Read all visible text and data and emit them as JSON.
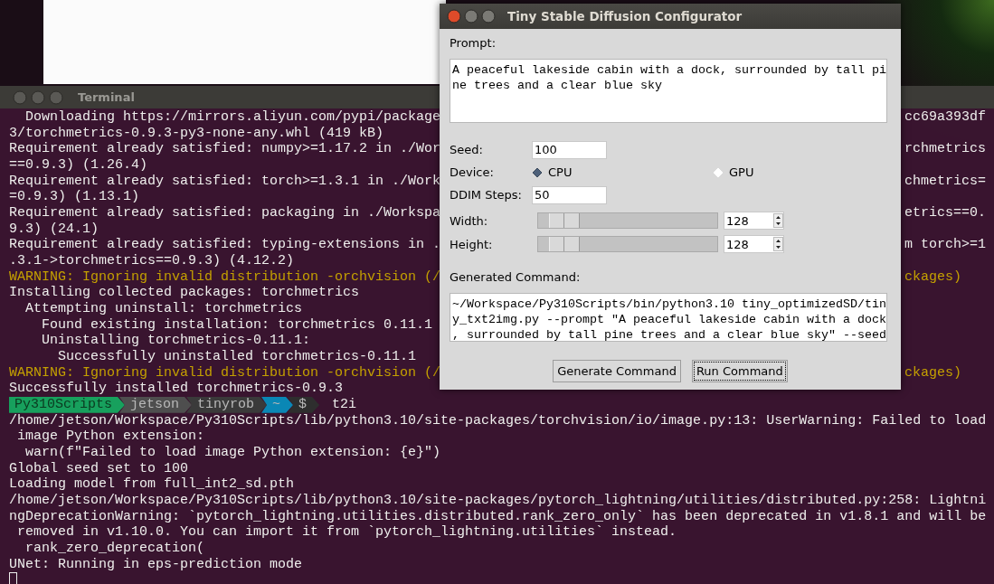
{
  "terminal": {
    "title": "Terminal",
    "lines": [
      {
        "kind": "normal",
        "text": "  Downloading https://mirrors.aliyun.com/pypi/package",
        "right": "cc69a393df"
      },
      {
        "kind": "normal",
        "text": "3/torchmetrics-0.9.3-py3-none-any.whl (419 kB)"
      },
      {
        "kind": "normal",
        "text": "Requirement already satisfied: numpy>=1.17.2 in ./Wor",
        "right": "rchmetrics"
      },
      {
        "kind": "normal",
        "text": "==0.9.3) (1.26.4)"
      },
      {
        "kind": "normal",
        "text": "Requirement already satisfied: torch>=1.3.1 in ./Work",
        "right": "chmetrics="
      },
      {
        "kind": "normal",
        "text": "=0.9.3) (1.13.1)"
      },
      {
        "kind": "normal",
        "text": "Requirement already satisfied: packaging in ./Workspa",
        "right": "etrics==0."
      },
      {
        "kind": "normal",
        "text": "9.3) (24.1)"
      },
      {
        "kind": "normal",
        "text": "Requirement already satisfied: typing-extensions in .",
        "right": "m torch>=1"
      },
      {
        "kind": "normal",
        "text": ".3.1->torchmetrics==0.9.3) (4.12.2)"
      },
      {
        "kind": "warning",
        "text": "WARNING: Ignoring invalid distribution -orchvision (/",
        "right": "ckages)"
      },
      {
        "kind": "normal",
        "text": "Installing collected packages: torchmetrics"
      },
      {
        "kind": "normal",
        "text": "  Attempting uninstall: torchmetrics"
      },
      {
        "kind": "normal",
        "text": "    Found existing installation: torchmetrics 0.11.1"
      },
      {
        "kind": "normal",
        "text": "    Uninstalling torchmetrics-0.11.1:"
      },
      {
        "kind": "normal",
        "text": "      Successfully uninstalled torchmetrics-0.11.1"
      },
      {
        "kind": "warning",
        "text": "WARNING: Ignoring invalid distribution -orchvision (/",
        "right": "ckages)"
      },
      {
        "kind": "normal",
        "text": "Successfully installed torchmetrics-0.9.3"
      },
      {
        "kind": "prompt",
        "segments": [
          {
            "text": "Py310Scripts",
            "color": "#17a05d"
          },
          {
            "text": "jetson",
            "color": "#4e4e4e"
          },
          {
            "text": "tinyrob",
            "color": "#3a3a3a"
          },
          {
            "text": "~",
            "color": "#0a87b5"
          },
          {
            "text": "$",
            "color": "#2e2e2e"
          }
        ],
        "text": "t2i"
      },
      {
        "kind": "normal",
        "text": "/home/jetson/Workspace/Py310Scripts/lib/python3.10/site-packages/torchvision/io/image.py:13: UserWarning: Failed to load"
      },
      {
        "kind": "normal",
        "text": " image Python extension:"
      },
      {
        "kind": "normal",
        "text": "  warn(f\"Failed to load image Python extension: {e}\")"
      },
      {
        "kind": "normal",
        "text": "Global seed set to 100"
      },
      {
        "kind": "normal",
        "text": "Loading model from full_int2_sd.pth"
      },
      {
        "kind": "normal",
        "text": "/home/jetson/Workspace/Py310Scripts/lib/python3.10/site-packages/pytorch_lightning/utilities/distributed.py:258: Lightni"
      },
      {
        "kind": "normal",
        "text": "ngDeprecationWarning: `pytorch_lightning.utilities.distributed.rank_zero_only` has been deprecated in v1.8.1 and will be"
      },
      {
        "kind": "normal",
        "text": " removed in v1.10.0. You can import it from `pytorch_lightning.utilities` instead."
      },
      {
        "kind": "normal",
        "text": "  rank_zero_deprecation("
      },
      {
        "kind": "normal",
        "text": "UNet: Running in eps-prediction mode"
      },
      {
        "kind": "cursor"
      }
    ]
  },
  "dialog": {
    "title": "Tiny Stable Diffusion Configurator",
    "prompt_label": "Prompt:",
    "prompt": "A peaceful lakeside cabin with a dock, surrounded by tall pine trees and a clear blue sky",
    "seed_label": "Seed:",
    "seed": "100",
    "device_label": "Device:",
    "devices": [
      {
        "label": "CPU",
        "selected": true
      },
      {
        "label": "GPU",
        "selected": false
      }
    ],
    "steps_label": "DDIM Steps:",
    "steps": "50",
    "sliders": [
      {
        "label": "Width:",
        "level": 0.07,
        "value": "128"
      },
      {
        "label": "Height:",
        "level": 0.07,
        "value": "128"
      }
    ],
    "command_label": "Generated Command:",
    "command": "~/Workspace/Py310Scripts/bin/python3.10 tiny_optimizedSD/tiny_txt2img.py --prompt \"A peaceful lakeside cabin with a dock, surrounded by tall pine trees and a clear blue sky\" --seed",
    "buttons": [
      {
        "label": "Generate Command",
        "focused": false
      },
      {
        "label": "Run Command",
        "focused": true
      }
    ]
  }
}
